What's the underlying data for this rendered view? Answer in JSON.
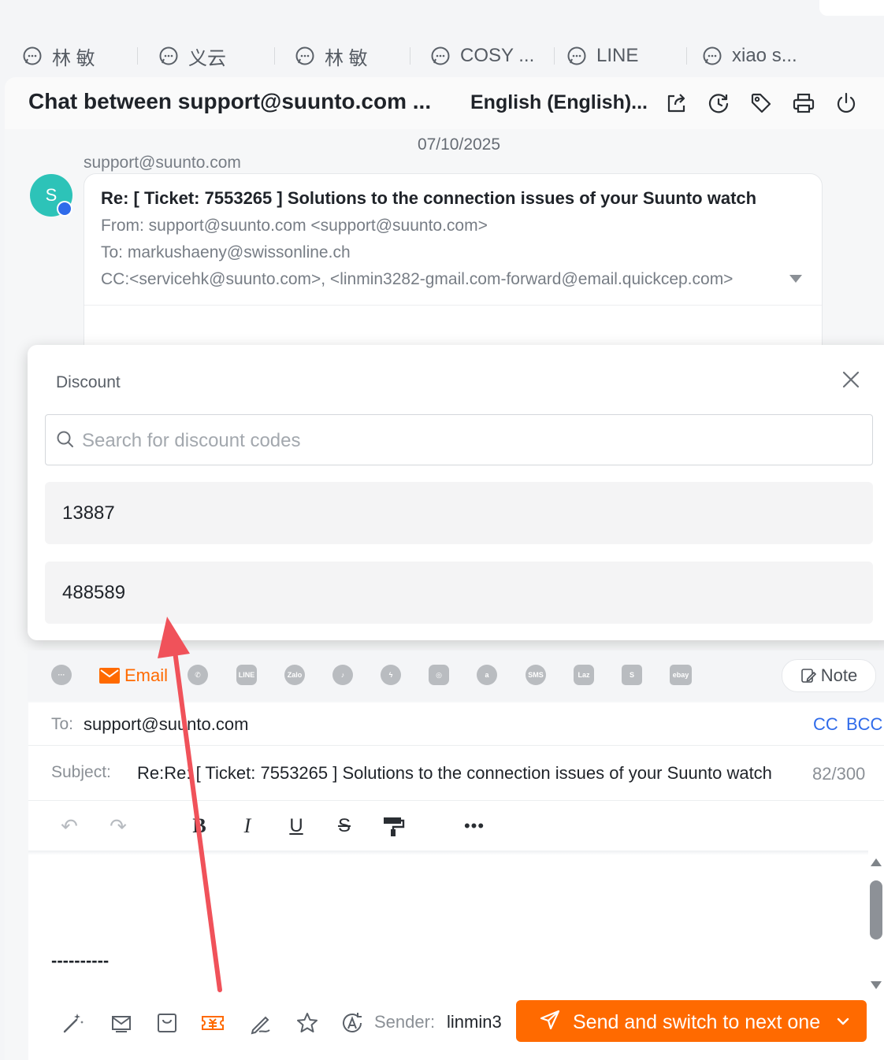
{
  "tabs": [
    {
      "label": "林 敏",
      "icon": "chat-bubble-icon"
    },
    {
      "label": "义云",
      "icon": "chat-bubble-icon"
    },
    {
      "label": "林 敏",
      "icon": "chat-bubble-icon"
    },
    {
      "label": "COSY ...",
      "icon": "chat-bubble-icon"
    },
    {
      "label": "LINE",
      "icon": "chat-bubble-icon"
    },
    {
      "label": "xiao s...",
      "icon": "chat-bubble-icon"
    }
  ],
  "header": {
    "title": "Chat between support@suunto.com ...",
    "language": "English (English)...",
    "icons": [
      "share-icon",
      "history-icon",
      "tag-icon",
      "print-icon",
      "power-icon"
    ]
  },
  "conversation": {
    "date": "07/10/2025",
    "sender": "support@suunto.com",
    "avatar_initial": "S",
    "email": {
      "subject": "Re: [ Ticket: 7553265 ] Solutions to the connection issues of your Suunto watch",
      "from": "From: support@suunto.com <support@suunto.com>",
      "to": "To: markushaeny@swissonline.ch",
      "cc": "CC:<servicehk@suunto.com>, <linmin3282-gmail.com-forward@email.quickcep.com>"
    }
  },
  "discount_popup": {
    "title": "Discount",
    "search_placeholder": "Search for discount codes",
    "codes": [
      "13887",
      "488589"
    ]
  },
  "channels": {
    "active_label": "Email",
    "note_label": "Note",
    "items": [
      "chat",
      "email",
      "whatsapp",
      "line",
      "zalo",
      "tiktok",
      "messenger",
      "instagram",
      "amazon",
      "sms",
      "lazada",
      "shopify",
      "ebay"
    ]
  },
  "compose": {
    "to_label": "To:",
    "to_value": "support@suunto.com",
    "cc_label": "CC",
    "bcc_label": "BCC",
    "subject_label": "Subject:",
    "subject_value": "Re:Re: [ Ticket: 7553265 ] Solutions to the connection issues of your Suunto watch",
    "subject_count": "82/300",
    "body_text": "----------",
    "sender_label": "Sender:",
    "sender_value": "linmin3",
    "send_label": "Send and switch to next one"
  },
  "colors": {
    "accent": "#ff6a00",
    "link": "#2f6bea",
    "avatar": "#2dc3b8",
    "annotation_arrow": "#f0525a"
  }
}
